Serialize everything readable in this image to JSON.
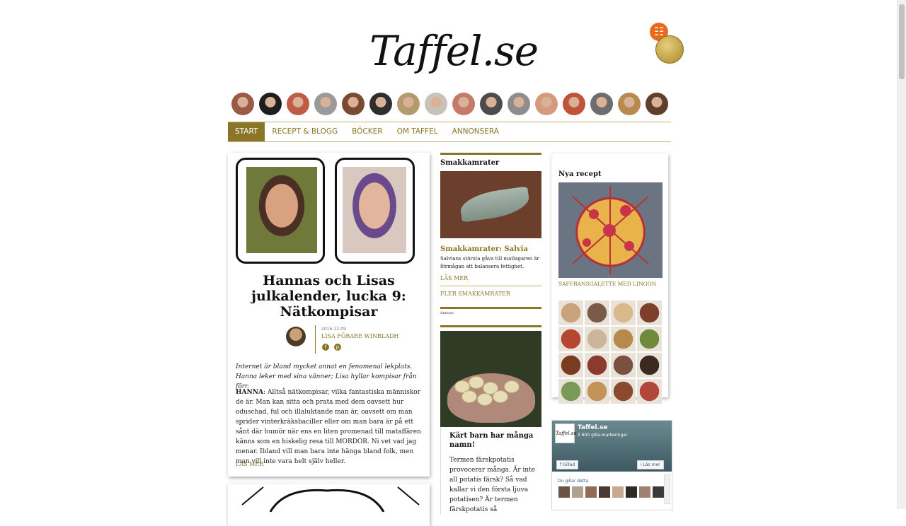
{
  "site": {
    "logo_text": "Taffel.se",
    "rss_icon": "rss-icon"
  },
  "bloggers": [
    {
      "color": "#9b5a45"
    },
    {
      "color": "#1e1e1e"
    },
    {
      "color": "#c05b45"
    },
    {
      "color": "#9a9a9a"
    },
    {
      "color": "#7a4a33"
    },
    {
      "color": "#2e2e2e"
    },
    {
      "color": "#b29b6e"
    },
    {
      "color": "#c8c2b8"
    },
    {
      "color": "#c77a6a"
    },
    {
      "color": "#4c4c4c"
    },
    {
      "color": "#8d8d8d"
    },
    {
      "color": "#d49a7f"
    },
    {
      "color": "#c0543a"
    },
    {
      "color": "#6d6d6d"
    },
    {
      "color": "#b98a50"
    },
    {
      "color": "#5e3f2a"
    }
  ],
  "nav": {
    "items": [
      "START",
      "RECEPT & BLOGG",
      "BÖCKER",
      "OM TAFFEL",
      "ANNONSERA"
    ],
    "active": 0
  },
  "article": {
    "title": "Hannas och Lisas julkalender, lucka 9: Nätkompisar",
    "date": "2016-12-09",
    "author": "LISA FÖRARE WINBLADH",
    "intro": "Internet är bland mycket annat en fenomenal lekplats. Hanna leker med sina vänner; Lisa hyllar kompisar från förr.",
    "body_speaker": "HANNA",
    "body": ": Alltså nätkompisar, vilka fantastiska människor de är. Man kan sitta och prata med dem oavsett hur oduschad, ful och illaluktande man är, oavsett om man sprider vinterkräksbaciller eller om man bara är på ett sånt där humör när ens en liten promenad till mataffären känns som en hiskelig resa till MORDOR. Ni vet vad jag menar. Ibland vill man bara inte hänga bland folk, men man vill inte vara helt själv heller.",
    "read_more": "LÄS MER"
  },
  "smakkamrater": {
    "heading": "Smakkamrater",
    "subtitle": "Smakkamrater: Salvia",
    "desc": "Salvians största gåva till matlagaren är förmågan att balansera fettighet.",
    "read_more": "LÄS MER",
    "more": "FLER SMAKKAMRATER"
  },
  "ad_label": "Annons",
  "potato": {
    "title": "Kärt barn har många namn!",
    "text": "Termen färskpotatis provocerar många. Är inte all potatis färsk? Så vad kallar vi den första ljuva potatisen? Är termen färskpotatis så"
  },
  "nya_recept": {
    "heading": "Nya recept",
    "featured": "SAFFRANSGALETTE MED LINGON",
    "thumb_colors": [
      "#c9a27e",
      "#7a5a48",
      "#d7b98b",
      "#7d3e2a",
      "#b5462f",
      "#cbb59b",
      "#b58a4a",
      "#6f8a3a",
      "#7a3c20",
      "#8a3a2f",
      "#7a5040",
      "#3c2a20",
      "#7a9a5a",
      "#c4935a",
      "#8a4a30",
      "#b0473a"
    ]
  },
  "facebook": {
    "page_name": "Taffel.se",
    "likes": "3 600 gilla-markeringar",
    "liked": "Gillad",
    "learn_more": "Läs mer",
    "friends": "Du gillar detta",
    "face_colors": [
      "#6b5444",
      "#b0a090",
      "#8d6b55",
      "#4a3a30",
      "#c9a890",
      "#2e2a28",
      "#a08070",
      "#3a3a3a"
    ]
  }
}
